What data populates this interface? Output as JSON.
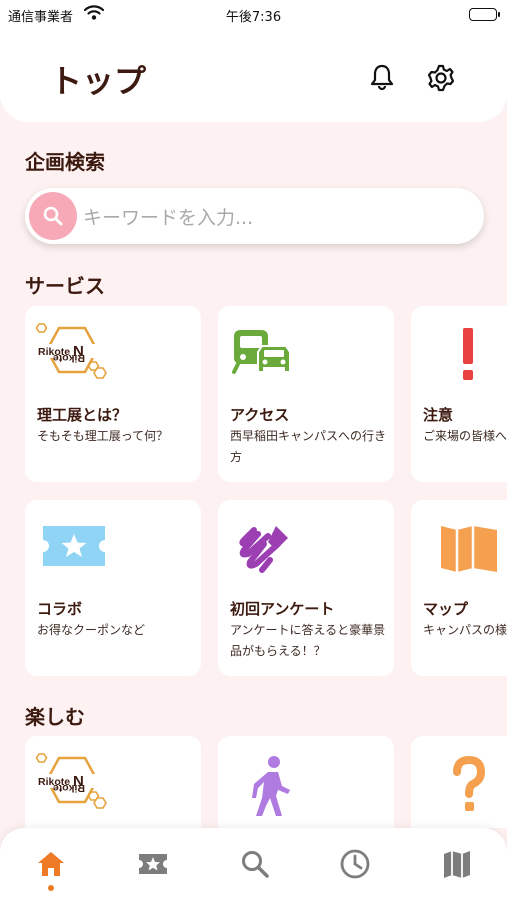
{
  "status_bar": {
    "carrier": "通信事業者",
    "time": "午後7:36"
  },
  "header": {
    "title": "トップ",
    "icons": [
      "bell-icon",
      "gear-icon"
    ]
  },
  "search_section": {
    "title": "企画検索",
    "placeholder": "キーワードを入力..."
  },
  "services": {
    "title": "サービス",
    "row1": [
      {
        "name": "理工展とは？",
        "desc": "そもそも理工展って何？",
        "icon": "rikoten-logo"
      },
      {
        "name": "アクセス",
        "desc": "西早稲田キャンパスへの行き方",
        "icon": "transit-icon"
      },
      {
        "name": "注意",
        "desc": "ご来場の皆様へ注意事項",
        "icon": "exclamation-icon"
      }
    ],
    "row2": [
      {
        "name": "コラボ",
        "desc": "お得なクーポンなど",
        "icon": "coupon-icon"
      },
      {
        "name": "初回アンケート",
        "desc": "アンケートに答えると豪華景品がもらえる！？",
        "icon": "draw-icon"
      },
      {
        "name": "マップ",
        "desc": "キャンパスの様子",
        "icon": "map-icon"
      }
    ]
  },
  "enjoy": {
    "title": "楽しむ",
    "icons": [
      "rikoten-logo",
      "walk-icon",
      "question-icon"
    ]
  },
  "bottom_nav": [
    "home-icon",
    "ticket-star-icon",
    "search-icon",
    "clock-icon",
    "map-icon"
  ],
  "colors": {
    "background": "#fdf1f1",
    "text": "#3d1a10",
    "search_accent": "#f7a9b7",
    "nav_active": "#ef7a26",
    "transit": "#6aaa3a",
    "alert": "#e8413f",
    "coupon": "#8fd3f5",
    "draw": "#9b3fb3",
    "map": "#f4a04e",
    "walk": "#b07be0",
    "question": "#f4a04e",
    "logo": "#e6a23c"
  }
}
